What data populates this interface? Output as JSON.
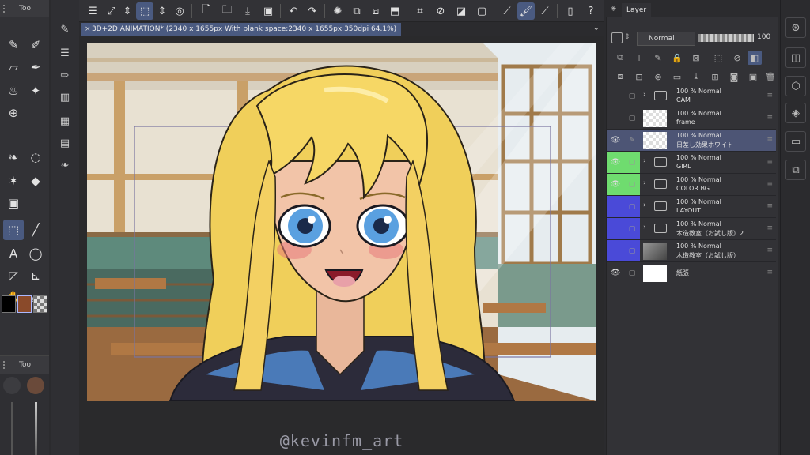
{
  "left_panel": {
    "tab_label": "Too",
    "bottom_tab_label": "Too",
    "swatch_main": "#000000",
    "swatch_sub": "#8a4a2a"
  },
  "document": {
    "tab_title": "3D+2D ANIMATION* (2340 x 1655px With blank space:2340 x 1655px 350dpi 64.1%)"
  },
  "layer_panel": {
    "tab_label": "Layer",
    "blend_mode": "Normal",
    "opacity": "100",
    "layers": [
      {
        "percent": "100 %  Normal",
        "name": "CAM",
        "kind": "folder",
        "visible": false,
        "selected": false,
        "color": ""
      },
      {
        "percent": "100 %  Normal",
        "name": "frame",
        "kind": "raster",
        "visible": false,
        "selected": false,
        "color": ""
      },
      {
        "percent": "100 %  Normal",
        "name": "日差し効果ホワイト",
        "kind": "raster",
        "visible": true,
        "selected": true,
        "color": ""
      },
      {
        "percent": "100 %  Normal",
        "name": "GIRL",
        "kind": "folder",
        "visible": true,
        "selected": false,
        "color": "#6fdc6f"
      },
      {
        "percent": "100 %  Normal",
        "name": "COLOR BG",
        "kind": "folder",
        "visible": true,
        "selected": false,
        "color": "#6fdc6f"
      },
      {
        "percent": "100 %  Normal",
        "name": "LAYOUT",
        "kind": "folder",
        "visible": false,
        "selected": false,
        "color": "#4a4ad8"
      },
      {
        "percent": "100 %  Normal",
        "name": "木造教室（お試し版）2",
        "kind": "folder",
        "visible": false,
        "selected": false,
        "color": "#4a4ad8"
      },
      {
        "percent": "100 %  Normal",
        "name": "木造教室（お試し版）",
        "kind": "3d",
        "visible": false,
        "selected": false,
        "color": "#4a4ad8"
      },
      {
        "percent": "",
        "name": "紙張",
        "kind": "paper",
        "visible": true,
        "selected": false,
        "color": ""
      }
    ]
  },
  "watermark": "@kevinfm_art"
}
